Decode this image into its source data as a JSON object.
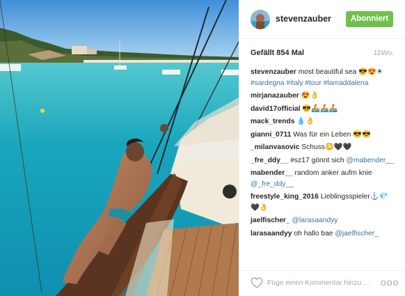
{
  "post": {
    "username": "stevenzauber",
    "follow_label": "Abonniert",
    "likes": "Gefällt 854 Mal",
    "age": "11Wo.",
    "caption": {
      "user": "stevenzauber",
      "text": "most beautiful sea 😎😍☀",
      "tags": "#sardegna #italy #tour #lamaddalena"
    },
    "comments": [
      {
        "user": "mirjanazauber",
        "text": "😍👌"
      },
      {
        "user": "david17official",
        "text": "😎🚣🚣🚣"
      },
      {
        "user": "mack_trends",
        "text": "💧👌"
      },
      {
        "user": "gianni_0711",
        "text": "Was für ein Leben 😎😎"
      },
      {
        "user": "_milanvasovic",
        "text": "Schuss😳🖤🖤"
      },
      {
        "user": "_fre_ddy__",
        "text": "#sz17 gönnt sich",
        "mention": "@mabender__"
      },
      {
        "user": "mabender__",
        "text": "random anker aufm knie",
        "mention": "@_fre_ddy__"
      },
      {
        "user": "freestyle_king_2016",
        "text": "Lieblingsspieler⚓💎",
        "extra": "🖤👌"
      },
      {
        "user": "jaelfischer_",
        "text": "",
        "mention": "@larasaandyy"
      },
      {
        "user": "larasaandyy",
        "text": "oh hallo bae",
        "mention": "@jaelfischer_"
      }
    ],
    "comment_placeholder": "Füge einen Kommentar hinzu ...",
    "more_label": "ooo"
  },
  "icons": {
    "like": "heart-icon",
    "more": "more-options-icon"
  },
  "colors": {
    "follow_button": "#70c050",
    "link": "#3f729b",
    "muted": "#a5a7aa"
  }
}
